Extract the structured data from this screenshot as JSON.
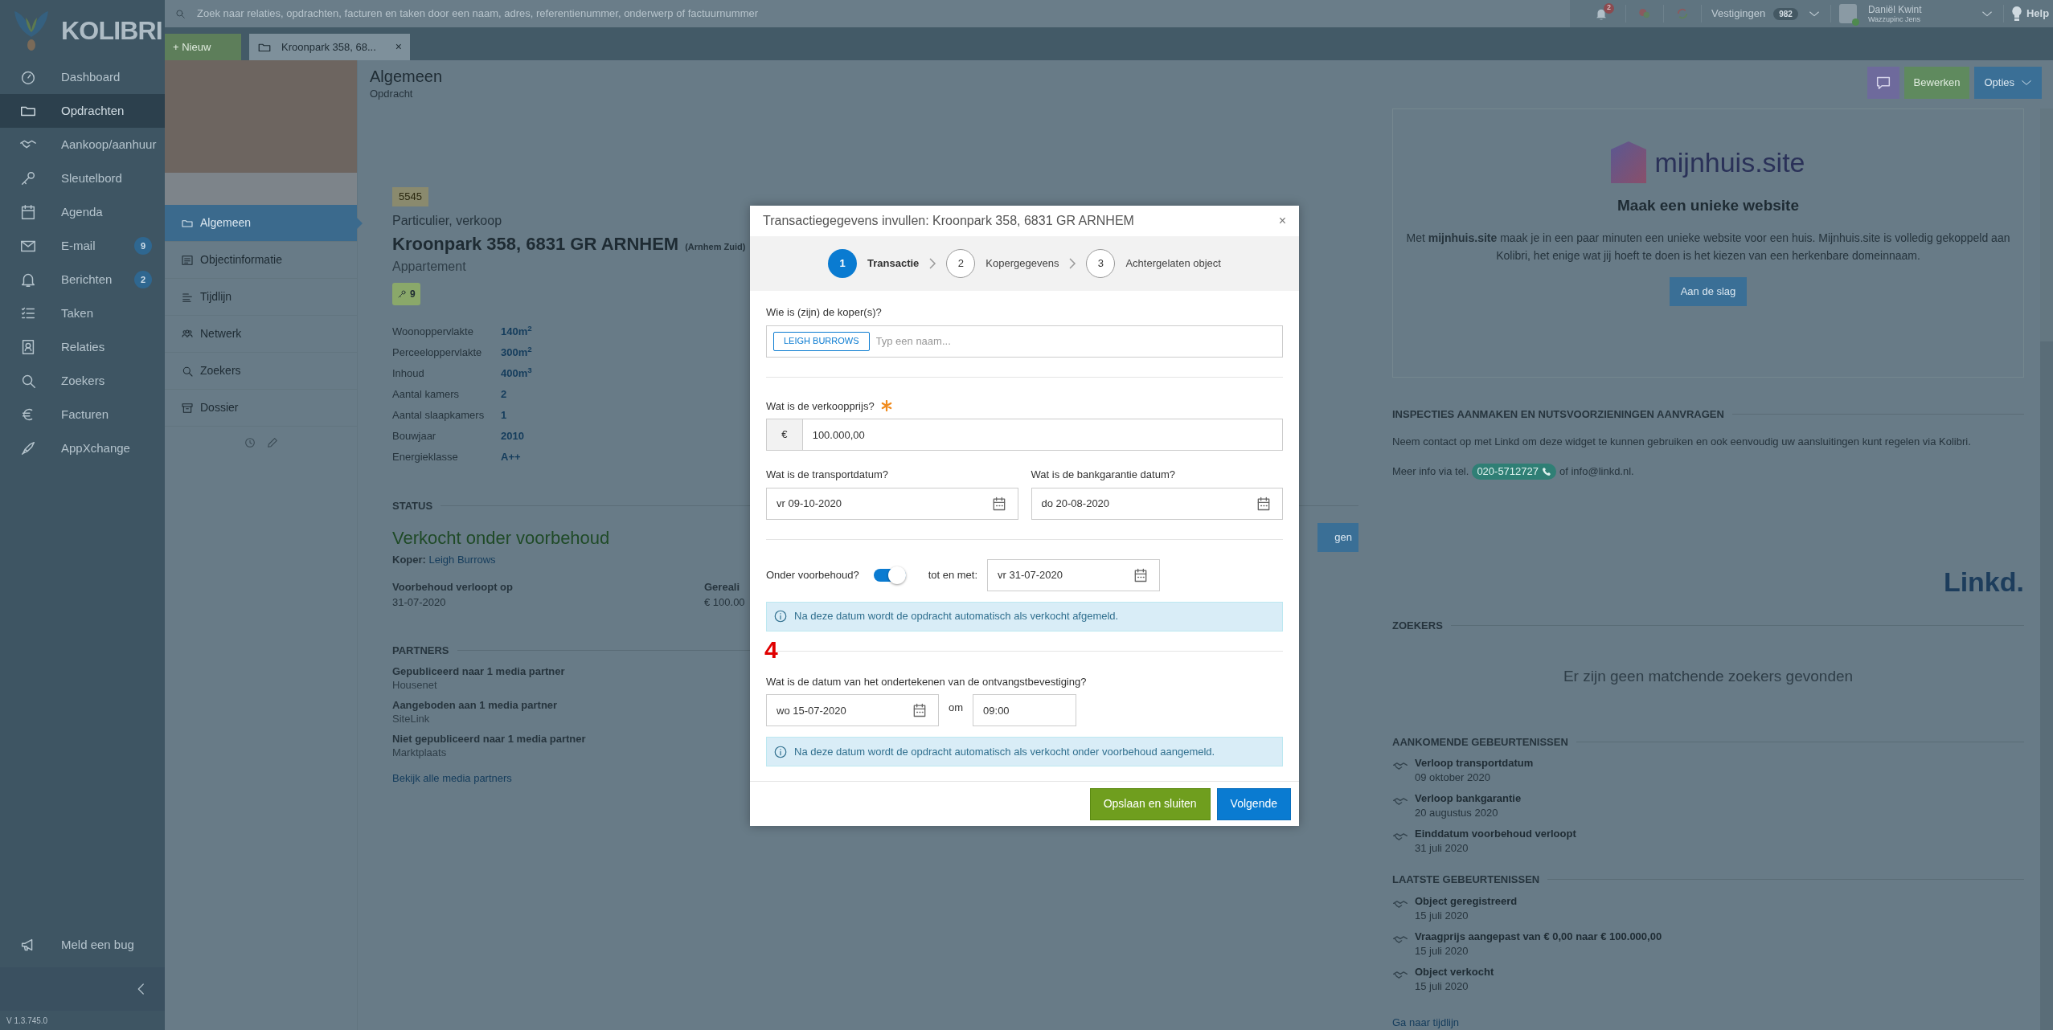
{
  "topbar": {
    "search": {
      "placeholder": "Zoek naar relaties, opdrachten, facturen en taken door een naam, adres, referentienummer, onderwerp of factuurnummer"
    },
    "notification_count": "2",
    "branches": {
      "label": "Vestigingen",
      "count": "982"
    },
    "user": {
      "name": "Daniël Kwint",
      "subtitle": "Wazzupinc Jens"
    },
    "help": "Help"
  },
  "sidebar": {
    "logo_text": "KOLIBRI",
    "items": [
      {
        "label": "Dashboard",
        "selected": false
      },
      {
        "label": "Opdrachten",
        "selected": true
      },
      {
        "label": "Aankoop/aanhuur",
        "selected": false
      },
      {
        "label": "Sleutelbord",
        "selected": false
      },
      {
        "label": "Agenda",
        "selected": false
      },
      {
        "label": "E-mail",
        "badge": "9",
        "selected": false
      },
      {
        "label": "Berichten",
        "badge": "2",
        "selected": false
      },
      {
        "label": "Taken",
        "selected": false
      },
      {
        "label": "Relaties",
        "selected": false
      },
      {
        "label": "Zoekers",
        "selected": false
      },
      {
        "label": "Facturen",
        "selected": false
      },
      {
        "label": "AppXchange",
        "selected": false
      }
    ],
    "bug_report": "Meld een bug",
    "version": "V 1.3.745.0"
  },
  "tabbar": {
    "new_button": "+ Nieuw",
    "tabs": [
      {
        "label": "Kroonpark 358, 68...",
        "close": "×",
        "selected": true
      }
    ]
  },
  "object_menu": [
    {
      "label": "Algemeen",
      "selected": true
    },
    {
      "label": "Objectinformatie",
      "selected": false
    },
    {
      "label": "Tijdlijn",
      "selected": false
    },
    {
      "label": "Netwerk",
      "selected": false
    },
    {
      "label": "Zoekers",
      "selected": false
    },
    {
      "label": "Dossier",
      "selected": false
    }
  ],
  "header": {
    "title": "Algemeen",
    "subtitle": "Opdracht",
    "buttons": [
      {
        "label": "Bewerken",
        "kind": "edit"
      },
      {
        "label": "Opties",
        "kind": "options"
      }
    ]
  },
  "object": {
    "reference": "5545",
    "category": "Particulier, verkoop",
    "address": "Kroonpark 358, 6831 GR ARNHEM",
    "district": "(Arnhem Zuid)",
    "type": "Appartement",
    "key_count": "9",
    "properties": [
      {
        "label": "Woonoppervlakte",
        "value": "140m$^{2}$"
      },
      {
        "label": "Perceeloppervlakte",
        "value": "300m$^{2}$"
      },
      {
        "label": "Inhoud",
        "value": "400m$^{3}$"
      },
      {
        "label": "Aantal kamers",
        "value": "2"
      },
      {
        "label": "Aantal slaapkamers",
        "value": "1"
      },
      {
        "label": "Bouwjaar",
        "value": "2010"
      },
      {
        "label": "Energieklasse",
        "value": "A++"
      }
    ]
  },
  "status": {
    "heading": "STATUS",
    "state": "Verkocht onder voorbehoud",
    "buyer_label": "Koper:",
    "buyer": "Leigh Burrows",
    "button": "gen",
    "fields": [
      {
        "label": "Voorbehoud verloopt op",
        "value": "31-07-2020"
      },
      {
        "label": "Gereali",
        "value": "€ 100.00"
      }
    ]
  },
  "partners": {
    "heading": "PARTNERS",
    "items": [
      {
        "title": "Gepubliceerd naar 1 media partner",
        "name": "Housenet"
      },
      {
        "title": "Aangeboden aan 1 media partner",
        "name": "SiteLink"
      },
      {
        "title": "Niet gepubliceerd naar 1 media partner",
        "name": "Marktplaats"
      }
    ],
    "link": "Bekijk alle media partners"
  },
  "mijnhuis": {
    "logo": "mijnhuis.site",
    "title": "Maak een unieke website",
    "text": "Met **mijnhuis.site** maak je in een paar minuten een unieke website voor een huis. Mijnhuis.site is volledig gekoppeld aan Kolibri, het enige wat jij hoeft te doen is het kiezen van een herkenbare domeinnaam.",
    "button": "Aan de slag"
  },
  "linkd": {
    "heading": "INSPECTIES AANMAKEN EN NUTSVOORZIENINGEN AANVRAGEN",
    "text": "Neem contact op met Linkd om deze widget te kunnen gebruiken en ook eenvoudig uw aansluitingen kunt regelen via Kolibri.",
    "info_prefix": "Meer info via tel.",
    "phone": "020-5712727",
    "info_suffix": "of info@linkd.nl.",
    "logo": "Linkd."
  },
  "zoekers": {
    "heading": "ZOEKERS",
    "empty": "Er zijn geen matchende zoekers gevonden"
  },
  "upcoming": {
    "heading": "AANKOMENDE GEBEURTENISSEN",
    "items": [
      {
        "title": "Verloop transportdatum",
        "date": "09 oktober 2020"
      },
      {
        "title": "Verloop bankgarantie",
        "date": "20 augustus 2020"
      },
      {
        "title": "Einddatum voorbehoud verloopt",
        "date": "31 juli 2020"
      }
    ]
  },
  "recent": {
    "heading": "LAATSTE GEBEURTENISSEN",
    "items": [
      {
        "title": "Object geregistreerd",
        "date": "15 juli 2020"
      },
      {
        "title": "Vraagprijs aangepast van € 0,00 naar € 100.000,00",
        "date": "15 juli 2020"
      },
      {
        "title": "Object verkocht",
        "date": "15 juli 2020"
      }
    ],
    "link": "Ga naar tijdlijn"
  },
  "modal": {
    "title": "Transactiegegevens invullen: Kroonpark 358, 6831 GR ARNHEM",
    "close": "×",
    "steps": [
      {
        "number": "1",
        "label": "Transactie",
        "selected": true
      },
      {
        "number": "2",
        "label": "Kopergegevens",
        "selected": false
      },
      {
        "number": "3",
        "label": "Achtergelaten object",
        "selected": false
      }
    ],
    "buyers": {
      "label": "Wie is (zijn) de koper(s)?",
      "tags": [
        "LEIGH BURROWS"
      ],
      "placeholder": "Typ een naam..."
    },
    "price": {
      "label": "Wat is de verkoopprijs?",
      "required": true,
      "currency": "€",
      "value": "100.000,00"
    },
    "transport_date": {
      "label": "Wat is de transportdatum?",
      "value": "vr 09-10-2020"
    },
    "bank_date": {
      "label": "Wat is de bankgarantie datum?",
      "value": "do 20-08-2020"
    },
    "reservation": {
      "label": "Onder voorbehoud?",
      "on": true,
      "until_label": "tot en met:",
      "value": "vr 31-07-2020",
      "info": "Na deze datum wordt de opdracht automatisch als verkocht afgemeld."
    },
    "signing": {
      "label": "Wat is de datum van het ondertekenen van de ontvangstbevestiging?",
      "date": "wo 15-07-2020",
      "at_label": "om",
      "time": "09:00",
      "info": "Na deze datum wordt de opdracht automatisch als verkocht onder voorbehoud aangemeld."
    },
    "buttons": [
      {
        "label": "Opslaan en sluiten",
        "kind": "save"
      },
      {
        "label": "Volgende",
        "kind": "next"
      }
    ]
  },
  "annotation": "4"
}
